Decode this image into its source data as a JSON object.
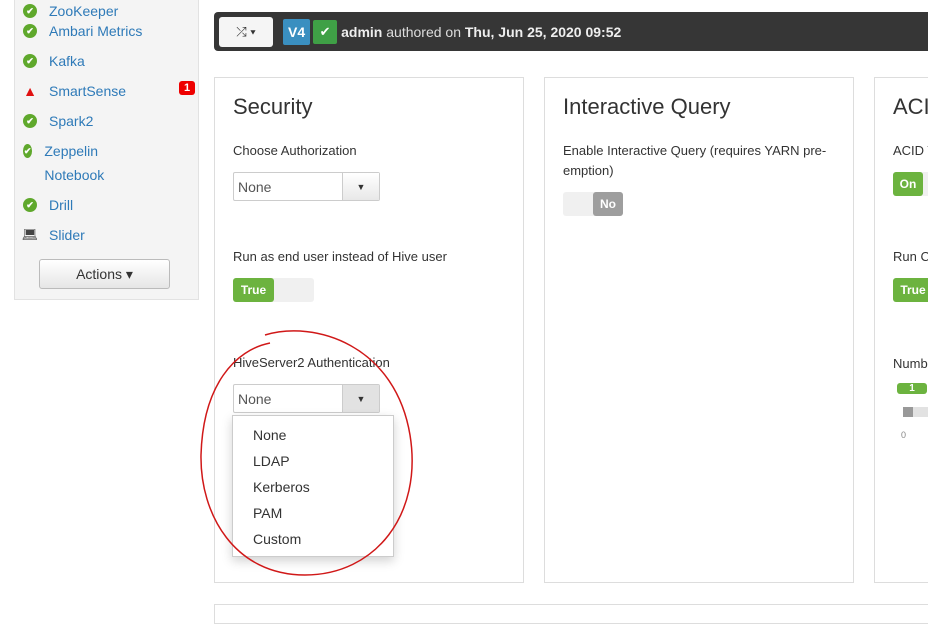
{
  "sidebar": {
    "items": [
      {
        "label": "ZooKeeper",
        "status": "ok"
      },
      {
        "label": "Ambari Metrics",
        "status": "ok"
      },
      {
        "label": "Kafka",
        "status": "ok"
      },
      {
        "label": "SmartSense",
        "status": "alert",
        "badge": "1"
      },
      {
        "label": "Spark2",
        "status": "ok"
      },
      {
        "label": "Zeppelin Notebook",
        "status": "ok"
      },
      {
        "label": "Drill",
        "status": "ok"
      },
      {
        "label": "Slider",
        "status": "client"
      }
    ],
    "actions_label": "Actions ▾"
  },
  "header": {
    "version": "V4",
    "user": "admin",
    "authored_text": "authored on",
    "date": "Thu, Jun 25, 2020 09:52"
  },
  "security": {
    "title": "Security",
    "choose_auth_label": "Choose Authorization",
    "choose_auth_value": "None",
    "run_as_label": "Run as end user instead of Hive user",
    "run_as_value": "True",
    "hs2_auth_label": "HiveServer2 Authentication",
    "hs2_auth_value": "None",
    "hs2_options": [
      "None",
      "LDAP",
      "Kerberos",
      "PAM",
      "Custom"
    ]
  },
  "interactive": {
    "title": "Interactive Query",
    "enable_label": "Enable Interactive Query (requires YARN pre-emption)",
    "enable_value": "No"
  },
  "acid": {
    "title": "ACI",
    "acid_label": "ACID T",
    "acid_value": "On",
    "run_label": "Run C",
    "run_value": "True",
    "number_label": "Numbe",
    "slider_value": "1",
    "slider_min": "0"
  },
  "colors": {
    "accent_green": "#6cb33f",
    "link": "#2e7ab8",
    "alert": "#e01010",
    "version_badge": "#3a8fc0"
  }
}
